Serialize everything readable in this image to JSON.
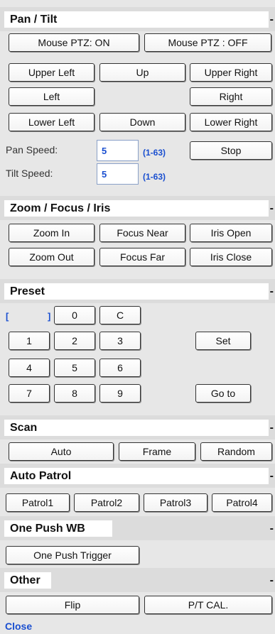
{
  "pan_tilt": {
    "title": "Pan / Tilt",
    "collapse": "-",
    "mouse_on": "Mouse PTZ: ON",
    "mouse_off": "Mouse PTZ : OFF",
    "upper_left": "Upper Left",
    "up": "Up",
    "upper_right": "Upper Right",
    "left": "Left",
    "right": "Right",
    "lower_left": "Lower Left",
    "down": "Down",
    "lower_right": "Lower Right",
    "pan_speed_label": "Pan Speed:",
    "pan_speed_value": "5",
    "pan_speed_range": "(1-63)",
    "stop": "Stop",
    "tilt_speed_label": "Tilt Speed:",
    "tilt_speed_value": "5",
    "tilt_speed_range": "(1-63)"
  },
  "zoom": {
    "title": "Zoom / Focus / Iris",
    "collapse": "-",
    "zoom_in": "Zoom In",
    "focus_near": "Focus Near",
    "iris_open": "Iris Open",
    "zoom_out": "Zoom Out",
    "focus_far": "Focus Far",
    "iris_close": "Iris Close"
  },
  "preset": {
    "title": "Preset",
    "collapse": "-",
    "bracket_open": "[",
    "bracket_close": "]",
    "keys": {
      "k0": "0",
      "c": "C",
      "k1": "1",
      "k2": "2",
      "k3": "3",
      "k4": "4",
      "k5": "5",
      "k6": "6",
      "k7": "7",
      "k8": "8",
      "k9": "9"
    },
    "set": "Set",
    "goto": "Go to"
  },
  "scan": {
    "title": "Scan",
    "collapse": "-",
    "auto": "Auto",
    "frame": "Frame",
    "random": "Random"
  },
  "patrol": {
    "title": "Auto Patrol",
    "collapse": "-",
    "p1": "Patrol1",
    "p2": "Patrol2",
    "p3": "Patrol3",
    "p4": "Patrol4"
  },
  "wb": {
    "title": "One Push WB",
    "collapse": "-",
    "trigger": "One Push Trigger"
  },
  "other": {
    "title": "Other",
    "collapse": "-",
    "flip": "Flip",
    "pt_cal": "P/T CAL."
  },
  "close": "Close"
}
